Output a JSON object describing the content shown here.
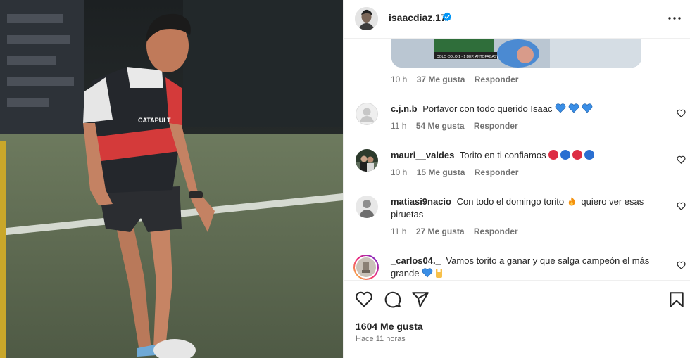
{
  "post": {
    "author": "isaacdiaz.17",
    "verified": true,
    "likes_text": "1604 Me gusta",
    "time_text": "Hace 11 horas"
  },
  "photo": {
    "vest_text": "CATAPULT"
  },
  "reply_media": {
    "caption": "COLO COLO 1 - 1 DEP. ANTOFAGASTA"
  },
  "previous_comment_meta": {
    "time": "10 h",
    "likes": "37 Me gusta",
    "reply": "Responder"
  },
  "comments": [
    {
      "username": "c.j.n.b",
      "text": "Porfavor con todo querido Isaac",
      "emojis": [
        "blue-heart",
        "blue-heart",
        "blue-heart"
      ],
      "time": "11 h",
      "likes": "54 Me gusta",
      "reply": "Responder"
    },
    {
      "username": "mauri__valdes",
      "text": "Torito en ti confiamos",
      "emojis": [
        "red-circle",
        "blue-circle",
        "red-circle",
        "blue-circle"
      ],
      "time": "10 h",
      "likes": "15 Me gusta",
      "reply": "Responder"
    },
    {
      "username": "matiasi9nacio",
      "text_before_emoji": "Con todo el domingo torito",
      "text_after_emoji": "quiero ver esas piruetas",
      "emojis": [
        "fire"
      ],
      "time": "11 h",
      "likes": "27 Me gusta",
      "reply": "Responder"
    },
    {
      "username": "_carlos04._",
      "text": "Vamos torito a ganar y que salga campeón el más grande",
      "emojis": [
        "blue-heart",
        "rock-hand"
      ],
      "time": "",
      "likes": "",
      "reply": ""
    }
  ],
  "colors": {
    "verified": "#0095f6",
    "blue_heart": "#3a8ee6",
    "red_circle": "#dd2e44",
    "blue_circle": "#2a6fd1",
    "secondary_text": "#737373"
  },
  "icons": [
    "more-icon",
    "heart-icon",
    "comment-icon",
    "share-icon",
    "save-icon",
    "verified-icon"
  ]
}
